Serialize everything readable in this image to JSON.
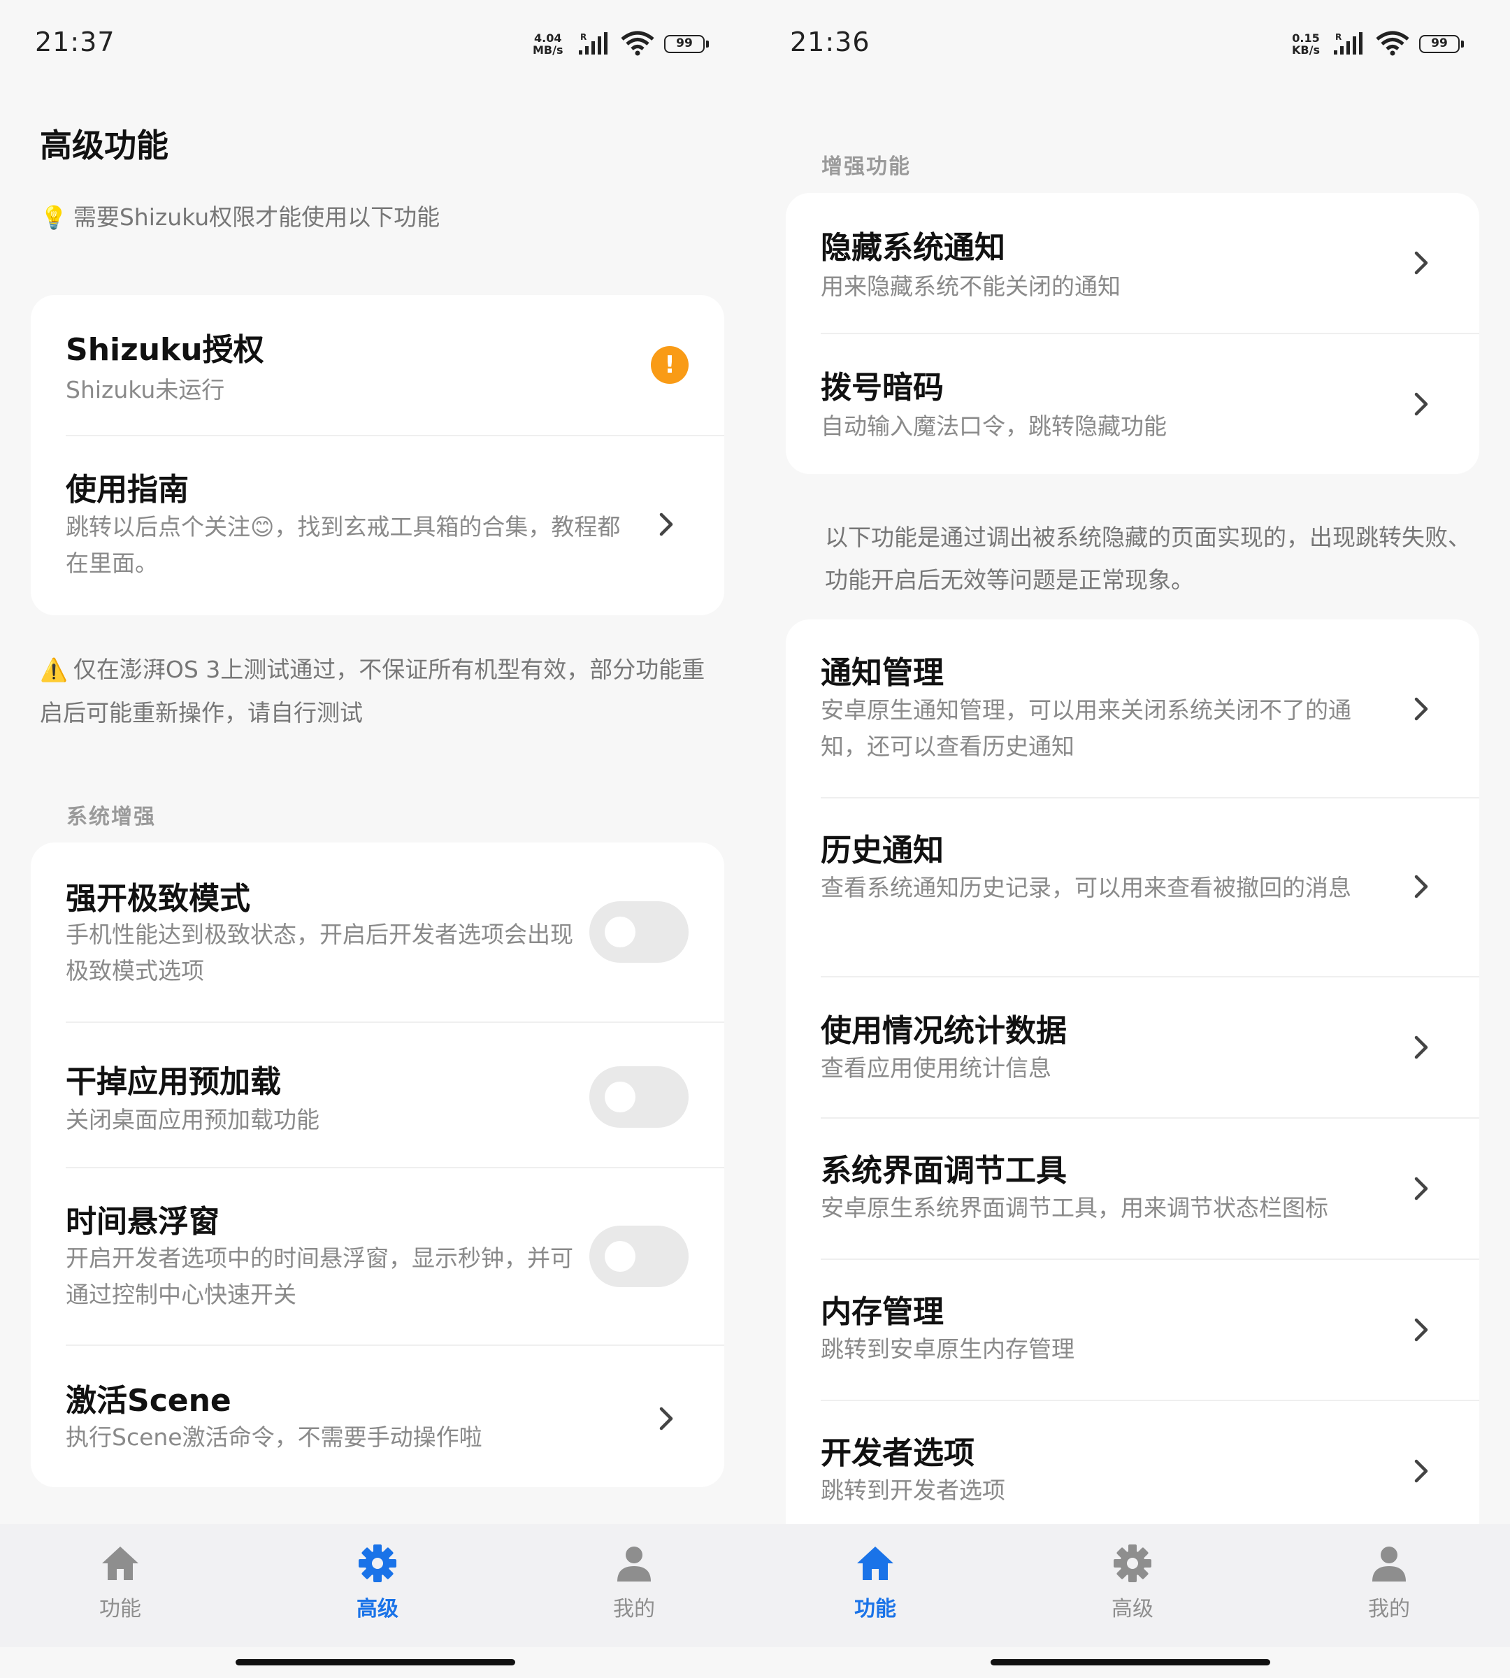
{
  "left": {
    "status": {
      "time": "21:37",
      "net_speed_value": "4.04",
      "net_speed_unit": "MB/s",
      "signal_tag": "R",
      "battery": "99"
    },
    "title": "高级功能",
    "notice": {
      "emoji": "💡",
      "text": "需要Shizuku权限才能使用以下功能"
    },
    "shizuku_card": {
      "auth": {
        "title": "Shizuku授权",
        "subtitle": "Shizuku未运行",
        "badge": "!"
      },
      "guide": {
        "title": "使用指南",
        "subtitle": "跳转以后点个关注😊，找到玄戒工具箱的合集，教程都在里面。"
      }
    },
    "warning": {
      "emoji": "⚠️",
      "text": "仅在澎湃OS 3上测试通过，不保证所有机型有效，部分功能重启后可能重新操作，请自行测试"
    },
    "section_label": "系统增强",
    "items": [
      {
        "title": "强开极致模式",
        "subtitle": "手机性能达到极致状态，开启后开发者选项会出现极致模式选项",
        "toggle_on": false
      },
      {
        "title": "干掉应用预加载",
        "subtitle": "关闭桌面应用预加载功能",
        "toggle_on": false
      },
      {
        "title": "时间悬浮窗",
        "subtitle": "开启开发者选项中的时间悬浮窗，显示秒钟，并可通过控制中心快速开关",
        "toggle_on": false
      },
      {
        "title": "激活Scene",
        "subtitle": "执行Scene激活命令，不需要手动操作啦"
      }
    ],
    "nav": [
      {
        "label": "功能",
        "icon": "home-icon",
        "active": false
      },
      {
        "label": "高级",
        "icon": "gear-icon",
        "active": true
      },
      {
        "label": "我的",
        "icon": "person-icon",
        "active": false
      }
    ]
  },
  "right": {
    "status": {
      "time": "21:36",
      "net_speed_value": "0.15",
      "net_speed_unit": "KB/s",
      "signal_tag": "R",
      "battery": "99"
    },
    "section_label": "增强功能",
    "top_items": [
      {
        "title": "隐藏系统通知",
        "subtitle": "用来隐藏系统不能关闭的通知"
      },
      {
        "title": "拨号暗码",
        "subtitle": "自动输入魔法口令，跳转隐藏功能"
      }
    ],
    "info_text": "以下功能是通过调出被系统隐藏的页面实现的，出现跳转失败、功能开启后无效等问题是正常现象。",
    "items": [
      {
        "title": "通知管理",
        "subtitle": "安卓原生通知管理，可以用来关闭系统关闭不了的通知，还可以查看历史通知"
      },
      {
        "title": "历史通知",
        "subtitle": "查看系统通知历史记录，可以用来查看被撤回的消息"
      },
      {
        "title": "使用情况统计数据",
        "subtitle": "查看应用使用统计信息"
      },
      {
        "title": "系统界面调节工具",
        "subtitle": "安卓原生系统界面调节工具，用来调节状态栏图标"
      },
      {
        "title": "内存管理",
        "subtitle": "跳转到安卓原生内存管理"
      },
      {
        "title": "开发者选项",
        "subtitle": "跳转到开发者选项"
      }
    ],
    "nav": [
      {
        "label": "功能",
        "icon": "home-icon",
        "active": true
      },
      {
        "label": "高级",
        "icon": "gear-icon",
        "active": false
      },
      {
        "label": "我的",
        "icon": "person-icon",
        "active": false
      }
    ]
  },
  "colors": {
    "accent": "#1a73e8",
    "warning_badge": "#f99b16",
    "toggle_off": "#e9e9e9",
    "background": "#f7f7f7",
    "card": "#ffffff"
  }
}
